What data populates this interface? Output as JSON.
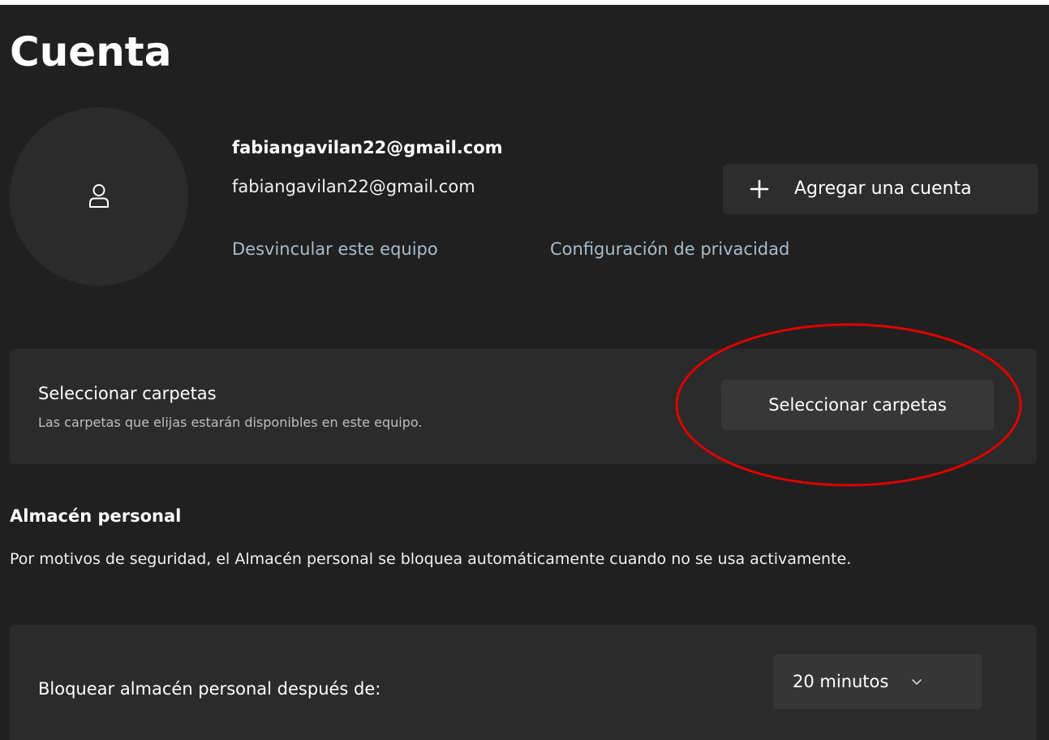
{
  "page": {
    "title": "Cuenta"
  },
  "account": {
    "display_name": "fabiangavilan22@gmail.com",
    "email": "fabiangavilan22@gmail.com",
    "avatar_icon": "person-icon",
    "add_account_label": "Agregar una cuenta",
    "unlink_label": "Desvincular este equipo",
    "privacy_label": "Configuración de privacidad"
  },
  "folders": {
    "title": "Seleccionar carpetas",
    "description": "Las carpetas que elijas estarán disponibles en este equipo.",
    "button_label": "Seleccionar carpetas"
  },
  "vault": {
    "heading": "Almacén personal",
    "description": "Por motivos de seguridad, el Almacén personal se bloquea automáticamente cuando no se usa activamente.",
    "lock_label": "Bloquear almacén personal después de:",
    "lock_selected": "20 minutos"
  },
  "colors": {
    "background": "#202020",
    "card": "#2b2b2b",
    "link": "#a9bcc9",
    "highlight": "#e00000"
  }
}
